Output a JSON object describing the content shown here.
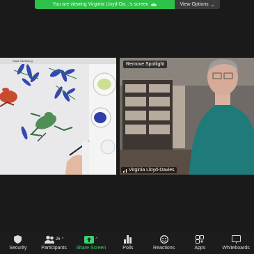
{
  "banner": {
    "viewing_text": "You are viewing Virginia Lloyd-Da...'s screen",
    "view_options": "View Options"
  },
  "shared_screen": {
    "header_text": "Stack Sketching"
  },
  "camera": {
    "spotlight_button": "Remove Spotlight",
    "participant_name": "Virginia Lloyd-Davies"
  },
  "toolbar": {
    "items": [
      {
        "label": "Security",
        "icon": "shield-icon"
      },
      {
        "label": "Participants",
        "icon": "participants-icon",
        "count": "26"
      },
      {
        "label": "Share Screen",
        "icon": "share-screen-icon"
      },
      {
        "label": "Polls",
        "icon": "polls-icon"
      },
      {
        "label": "Reactions",
        "icon": "reactions-icon"
      },
      {
        "label": "Apps",
        "icon": "apps-icon"
      },
      {
        "label": "Whiteboards",
        "icon": "whiteboard-icon"
      }
    ]
  },
  "colors": {
    "banner_green": "#2ec14a",
    "share_accent": "#3bd16f",
    "toolbar_bg": "#1c1c1c"
  }
}
